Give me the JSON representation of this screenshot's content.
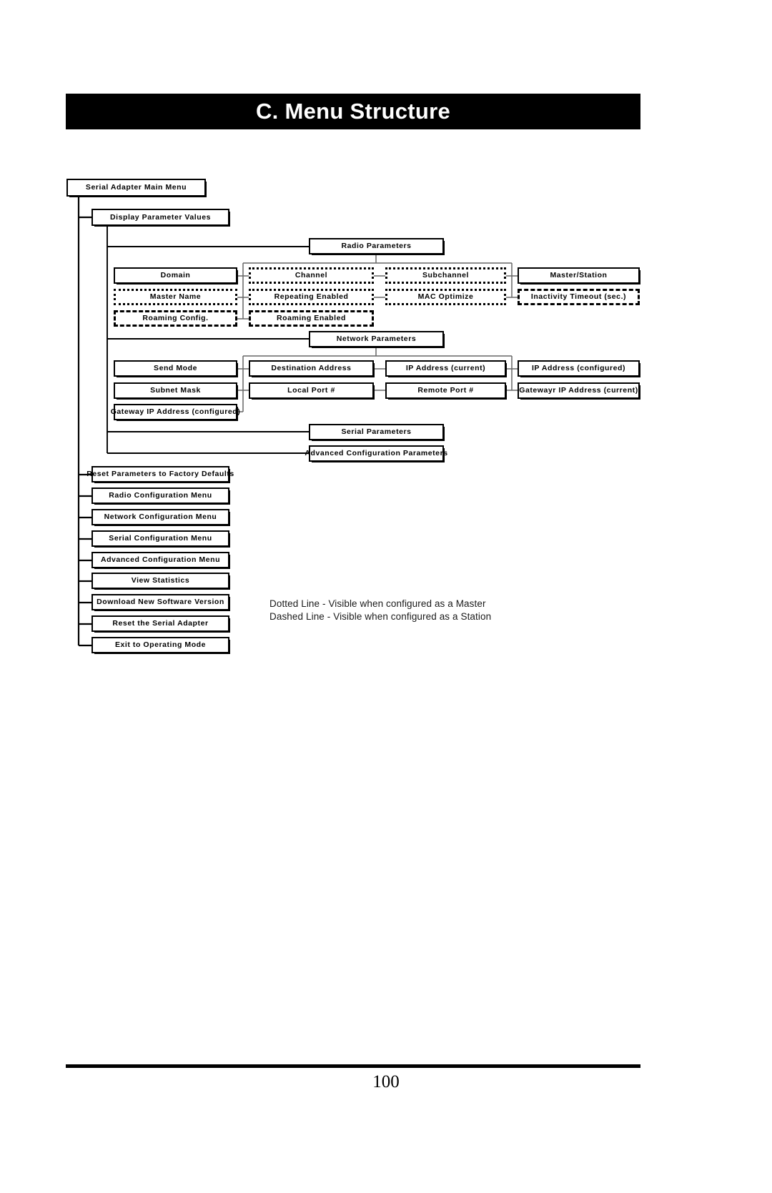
{
  "page": {
    "appendix_title": "C. Menu Structure",
    "page_number": "100"
  },
  "legend": {
    "dotted_line": "Dotted Line - Visible when configured as a Master",
    "dashed_line": "Dashed Line - Visible when configured as a Station"
  },
  "diagram": {
    "root": {
      "label": "Serial Adapter Main Menu",
      "style": "solid"
    },
    "display_parameter_values": {
      "label": "Display Parameter Values",
      "style": "solid"
    },
    "groups": [
      {
        "heading": {
          "label": "Radio Parameters",
          "style": "solid"
        },
        "items": [
          {
            "label": "Domain",
            "style": "solid"
          },
          {
            "label": "Channel",
            "style": "dotted"
          },
          {
            "label": "Subchannel",
            "style": "dotted"
          },
          {
            "label": "Master/Station",
            "style": "solid"
          },
          {
            "label": "Master Name",
            "style": "dotted"
          },
          {
            "label": "Repeating Enabled",
            "style": "dotted"
          },
          {
            "label": "MAC Optimize",
            "style": "dotted"
          },
          {
            "label": "Inactivity Timeout (sec.)",
            "style": "dashed"
          },
          {
            "label": "Roaming Config.",
            "style": "dashed"
          },
          {
            "label": "Roaming Enabled",
            "style": "dashed"
          }
        ]
      },
      {
        "heading": {
          "label": "Network Parameters",
          "style": "solid"
        },
        "items": [
          {
            "label": "Send Mode",
            "style": "solid"
          },
          {
            "label": "Destination Address",
            "style": "solid"
          },
          {
            "label": "IP Address (current)",
            "style": "solid"
          },
          {
            "label": "IP Address (configured)",
            "style": "solid"
          },
          {
            "label": "Subnet Mask",
            "style": "solid"
          },
          {
            "label": "Local  Port #",
            "style": "solid"
          },
          {
            "label": "Remote Port #",
            "style": "solid"
          },
          {
            "label": "Gatewayr IP Address (current)",
            "style": "solid"
          },
          {
            "label": "Gateway IP Address (configured)",
            "style": "solid"
          }
        ]
      }
    ],
    "serial_parameters": {
      "label": "Serial Parameters",
      "style": "solid"
    },
    "advanced_configuration_parameters": {
      "label": "Advanced Configuration Parameters",
      "style": "solid"
    },
    "main_menu_items": [
      {
        "label": "Reset Parameters to Factory Defaults",
        "style": "solid"
      },
      {
        "label": "Radio Configuration Menu",
        "style": "solid"
      },
      {
        "label": "Network Configuration Menu",
        "style": "solid"
      },
      {
        "label": "Serial Configuration Menu",
        "style": "solid"
      },
      {
        "label": "Advanced Configuration Menu",
        "style": "solid"
      },
      {
        "label": "View Statistics",
        "style": "solid"
      },
      {
        "label": "Download New Software Version",
        "style": "solid"
      },
      {
        "label": "Reset the Serial Adapter",
        "style": "solid"
      },
      {
        "label": "Exit to Operating Mode",
        "style": "solid"
      }
    ]
  }
}
